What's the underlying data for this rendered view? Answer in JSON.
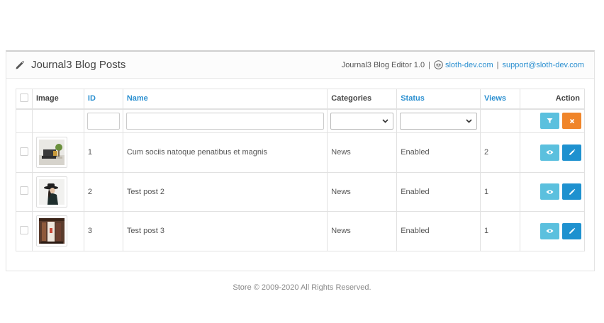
{
  "panel": {
    "title": "Journal3 Blog Posts",
    "editor_label": "Journal3 Blog Editor 1.0",
    "separator": "|",
    "site_link": "sloth-dev.com",
    "support_link": "support@sloth-dev.com"
  },
  "table": {
    "headers": {
      "image": "Image",
      "id": "ID",
      "name": "Name",
      "categories": "Categories",
      "status": "Status",
      "views": "Views",
      "action": "Action"
    },
    "filters": {
      "id_value": "",
      "name_value": "",
      "category_selected": "",
      "status_selected": ""
    },
    "rows": [
      {
        "id": "1",
        "name": "Cum sociis natoque penatibus et magnis",
        "category": "News",
        "status": "Enabled",
        "views": "2",
        "image_icon": "living-room-photo"
      },
      {
        "id": "2",
        "name": "Test post 2",
        "category": "News",
        "status": "Enabled",
        "views": "1",
        "image_icon": "woman-in-hat-photo"
      },
      {
        "id": "3",
        "name": "Test post 3",
        "category": "News",
        "status": "Enabled",
        "views": "1",
        "image_icon": "clothing-rack-photo"
      }
    ]
  },
  "footer": {
    "text": "Store © 2009-2020 All Rights Reserved."
  },
  "colors": {
    "link": "#2a8fd0",
    "info_button": "#5bc0de",
    "warning_button": "#f0852a",
    "primary_button": "#1e91cf"
  },
  "icons": {
    "title": "pencil-icon",
    "site": "sloth-logo-icon",
    "filter": "filter-icon",
    "clear": "close-icon",
    "view": "eye-icon",
    "edit": "pencil-icon",
    "select": "chevron-down-icon"
  }
}
